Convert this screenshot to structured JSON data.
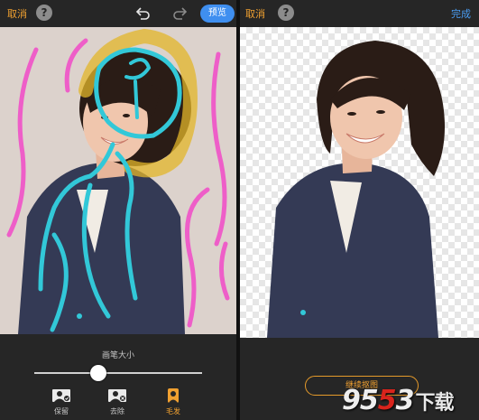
{
  "left_panel": {
    "topbar": {
      "cancel": "取消",
      "help": "?",
      "preview": "预览"
    },
    "brush_size_label": "画笔大小",
    "brush_size": 0.38,
    "tools": [
      {
        "label": "保留",
        "icon": "keep-person-icon"
      },
      {
        "label": "去除",
        "icon": "remove-person-icon"
      },
      {
        "label": "毛发",
        "icon": "hair-brush-icon"
      }
    ],
    "active_tool": 2
  },
  "right_panel": {
    "topbar": {
      "cancel": "取消",
      "help": "?",
      "done": "完成"
    },
    "continue_button": "继续抠图",
    "watermark": {
      "number_a": "95",
      "number_b": "5",
      "number_c": "3",
      "tail": "下载"
    }
  },
  "colors": {
    "accent_orange": "#f0a030",
    "accent_blue": "#3f8ff0",
    "stroke_keep": "#32c8d8",
    "stroke_remove": "#ee5ec8",
    "stroke_hair": "#e3b62a"
  }
}
